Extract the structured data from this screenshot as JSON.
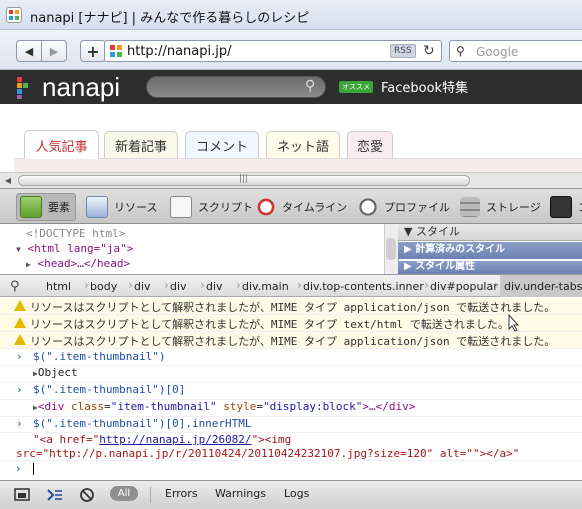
{
  "window": {
    "title": "nanapi [ナナピ] | みんなで作る暮らしのレシピ"
  },
  "browser": {
    "url": "http://nanapi.jp/",
    "rss_label": "RSS",
    "search_placeholder": "Google",
    "back_icon": "◀",
    "forward_icon": "▶",
    "new_tab_icon": "+",
    "reload_icon": "↻"
  },
  "site": {
    "logo_text": "nanapi",
    "promo_badge": "オススメ",
    "promo_label": "Facebook特集",
    "tabs": [
      {
        "label": "人気記事",
        "active": true
      },
      {
        "label": "新着記事",
        "active": false
      },
      {
        "label": "コメント",
        "active": false
      },
      {
        "label": "ネット語",
        "active": false
      },
      {
        "label": "恋愛",
        "active": false
      }
    ]
  },
  "devtools": {
    "tabs": [
      {
        "label": "要素",
        "icon": "elements-icon"
      },
      {
        "label": "リソース",
        "icon": "resources-icon"
      },
      {
        "label": "スクリプト",
        "icon": "scripts-icon"
      },
      {
        "label": "タイムライン",
        "icon": "timeline-icon"
      },
      {
        "label": "プロファイル",
        "icon": "profiles-icon"
      },
      {
        "label": "ストレージ",
        "icon": "storage-icon"
      },
      {
        "label": "コ",
        "icon": "console-icon"
      }
    ],
    "elements": {
      "doctype": "<!DOCTYPE html>",
      "html_open": "<html lang=\"ja\">",
      "head_collapsed": "<head>…</head>"
    },
    "styles": {
      "header": "スタイル",
      "computed": "計算済みのスタイル",
      "attributes": "スタイル属性"
    },
    "breadcrumb": [
      "html",
      "body",
      "div",
      "div",
      "div",
      "div.main",
      "div.top-contents.inner",
      "div#popular",
      "div.under-tabs."
    ],
    "console": {
      "warnings": [
        "リソースはスクリプトとして解釈されましたが、MIME タイプ application/json で転送されました。",
        "リソースはスクリプトとして解釈されましたが、MIME タイプ text/html で転送されました。",
        "リソースはスクリプトとして解釈されましたが、MIME タイプ application/json で転送されました。"
      ],
      "cmd1": "$(\".item-thumbnail\")",
      "res1": "Object",
      "cmd2": "$(\".item-thumbnail\")[0]",
      "res2_tag_open": "<div",
      "res2_attr1": "class",
      "res2_val1": "\"item-thumbnail\"",
      "res2_attr2": "style",
      "res2_val2": "\"display:block\"",
      "res2_tail": ">…</div>",
      "cmd3": "$(\".item-thumbnail\")[0].innerHTML",
      "res3_line1_a": "\"<a href=\"",
      "res3_line1_url": "http://nanapi.jp/26082/",
      "res3_line1_b": "\"><img",
      "res3_line2": "src=\"http://p.nanapi.jp/r/20110424/20110424232107.jpg?size=120\" alt=\"\"></a>\""
    },
    "statusbar": {
      "all": "All",
      "errors": "Errors",
      "warnings": "Warnings",
      "logs": "Logs"
    }
  }
}
